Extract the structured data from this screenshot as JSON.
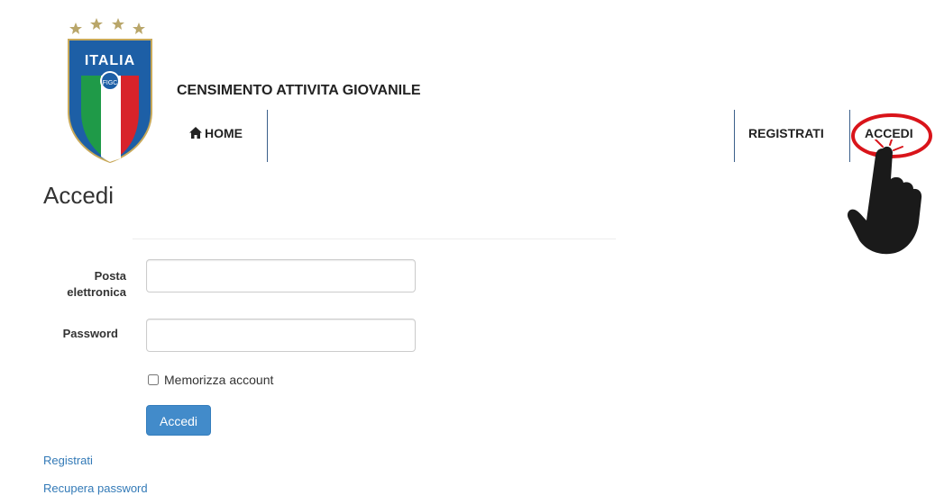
{
  "header": {
    "logo_text": "ITALIA",
    "site_title": "CENSIMENTO ATTIVITA GIOVANILE"
  },
  "nav": {
    "home_label": "HOME",
    "home_icon": "home-icon",
    "register_label": "REGISTRATI",
    "login_label": "ACCEDI"
  },
  "main": {
    "heading": "Accedi",
    "email_label": "Posta elettronica",
    "email_value": "",
    "password_label": "Password",
    "password_value": "",
    "remember_label": "Memorizza account",
    "remember_checked": false,
    "submit_label": "Accedi",
    "register_link": "Registrati",
    "recover_link": "Recupera password"
  },
  "colors": {
    "primary_button": "#428bca",
    "link": "#337ab7",
    "nav_separator": "#3b5f8a",
    "highlight_ring": "#d9141a"
  }
}
